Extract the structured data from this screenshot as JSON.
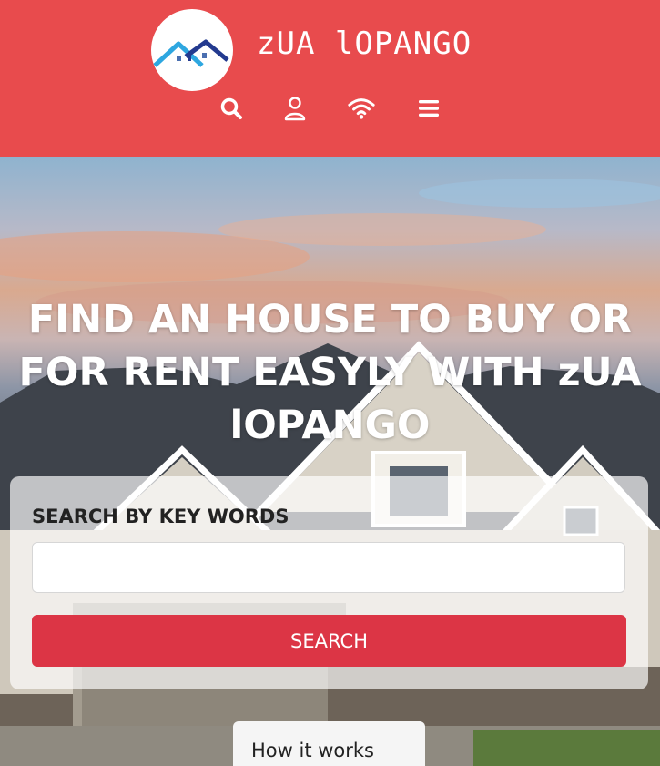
{
  "header": {
    "brand": "zUA lOPANGO",
    "logo": "house-roofs-logo",
    "background": "#e84b4d",
    "nav_icons": [
      "search-icon",
      "user-icon",
      "wifi-icon",
      "menu-icon"
    ]
  },
  "hero": {
    "title": "FIND AN HOUSE TO BUY OR FOR RENT EASYLY WITH zUA lOPANGO",
    "search": {
      "label": "SEARCH BY KEY WORDS",
      "value": "",
      "placeholder": "",
      "button_label": "SEARCH",
      "button_color": "#dc3545"
    }
  },
  "tabs": {
    "how_it_works": "How it works"
  }
}
